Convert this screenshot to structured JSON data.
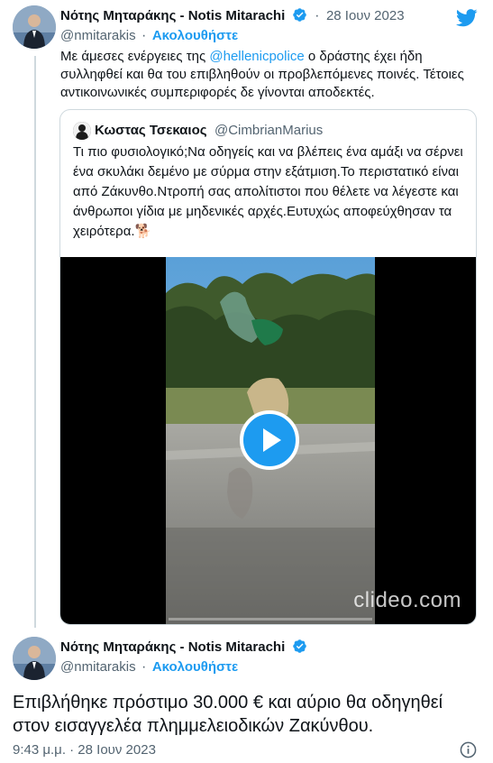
{
  "tweet1": {
    "author_name": "Νότης Μηταράκης - Notis Mitarachi",
    "handle": "@nmitarakis",
    "separator": "·",
    "follow_label": "Ακολουθήστε",
    "date": "28 Ιουν 2023",
    "text_before": "Με άμεσες ενέργειες της ",
    "mention": "@hellenicpolice",
    "text_after": " ο δράστης έχει ήδη συλληφθεί και θα του επιβληθούν οι προβλεπόμενες ποινές. Τέτοιες αντικοινωνικές συμπεριφορές δε γίνονται αποδεκτές."
  },
  "quote": {
    "author_name": "Κωστας Τσεκαιος",
    "handle": "@CimbrianMarius",
    "text": "Τι πιο φυσιολογικό;Να οδηγείς και να βλέπεις ένα αμάξι να σέρνει ένα σκυλάκι δεμένο με σύρμα στην εξάτμιση.Το περιστατικό είναι από Ζάκυνθο.Ντροπή σας απολίτιστοι που θέλετε να λέγεστε και άνθρωποι γίδια με μηδενικές αρχές.Ευτυχώς αποφεύχθησαν τα χειρότερα.",
    "emoji": "🐕",
    "video_watermark": "clideo.com"
  },
  "tweet2": {
    "author_name": "Νότης Μηταράκης - Notis Mitarachi",
    "handle": "@nmitarakis",
    "separator": "·",
    "follow_label": "Ακολουθήστε",
    "text": "Επιβλήθηκε πρόστιμο 30.000 € και αύριο θα οδηγηθεί στον εισαγγελέα πλημμελειοδικών Ζακύνθου.",
    "timestamp": "9:43 μ.μ. · 28 Ιουν 2023"
  },
  "icons": {
    "brand": "twitter-bird-icon",
    "verified": "verified-badge-icon",
    "play": "play-icon",
    "info": "info-icon"
  },
  "colors": {
    "accent": "#1d9bf0",
    "text": "#0f1419",
    "secondary": "#536471",
    "border": "#cfd9de"
  }
}
